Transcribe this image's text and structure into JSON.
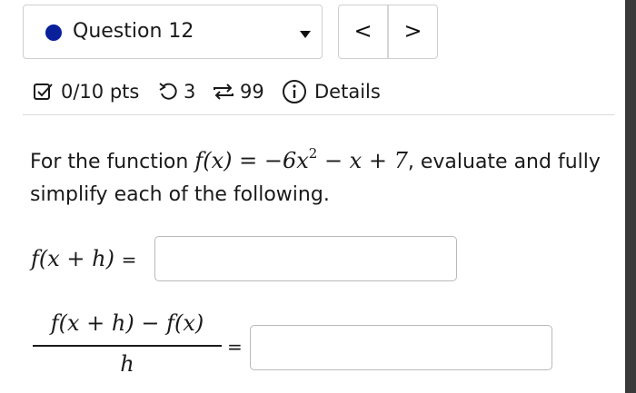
{
  "question": {
    "label": "Question 12",
    "status_color": "#0a1f9a",
    "dropdown_icon": "caret-down-icon"
  },
  "nav": {
    "prev_label": "<",
    "next_label": ">"
  },
  "meta": {
    "score": "0/10 pts",
    "attempts": "3",
    "submissions": "99",
    "details_label": "Details",
    "icons": [
      "checkbox-icon",
      "retry-icon",
      "repeat-icon",
      "info-icon"
    ]
  },
  "prompt": {
    "text_before": "For the function ",
    "function_lhs": "f(x)",
    "function_eq": " = −6x",
    "function_exp": "2",
    "function_rest": " − x + 7",
    "text_after": ", evaluate and fully simplify each of the following."
  },
  "parts": [
    {
      "lhs": "f(x + h)",
      "equals": "=",
      "answer": ""
    },
    {
      "numerator": "f(x + h) − f(x)",
      "denominator": "h",
      "equals": "=",
      "answer": ""
    }
  ]
}
